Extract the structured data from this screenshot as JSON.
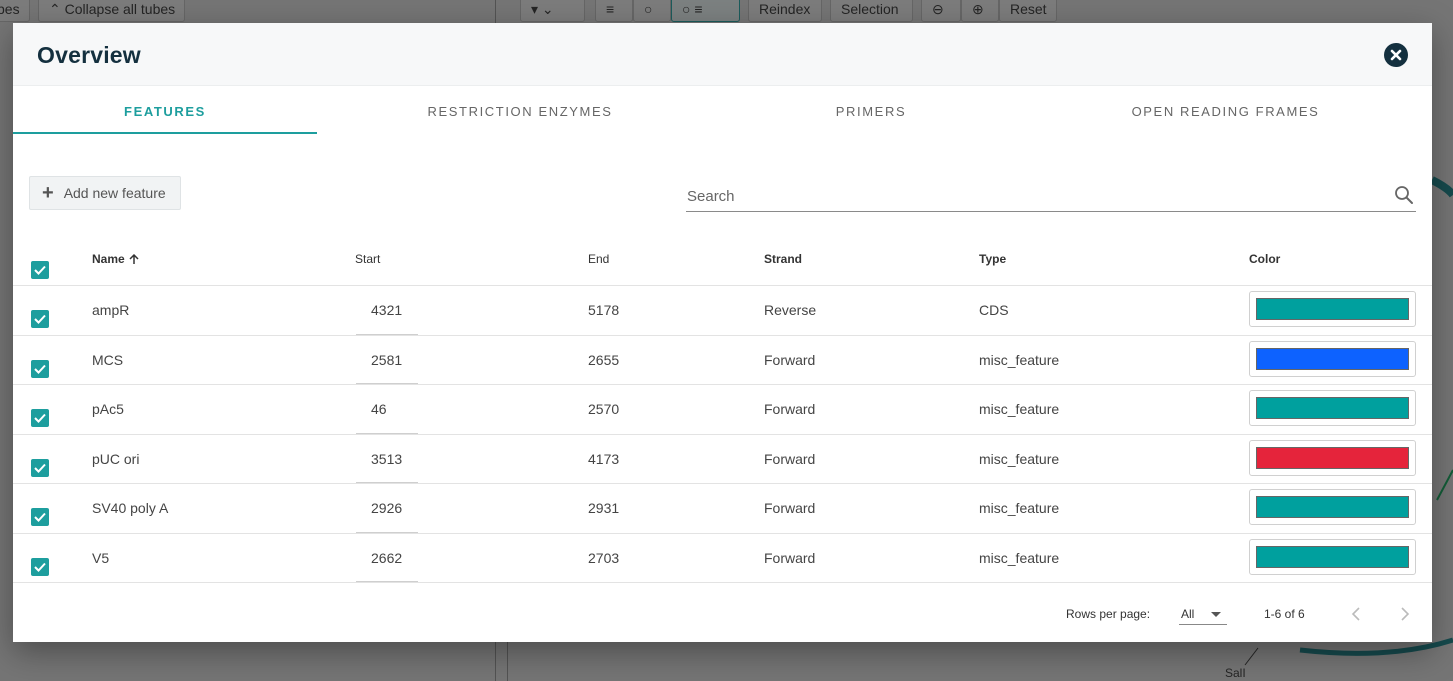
{
  "background": {
    "toolbar": {
      "partial_left_label": "bes",
      "collapse_label": "Collapse all tubes",
      "reindex_label": "Reindex",
      "selection_label": "Selection",
      "reset_label": "Reset"
    },
    "map_label": "SalI"
  },
  "modal": {
    "title": "Overview",
    "tabs": [
      {
        "label": "Features",
        "active": true
      },
      {
        "label": "Restriction Enzymes",
        "active": false
      },
      {
        "label": "Primers",
        "active": false
      },
      {
        "label": "Open Reading Frames",
        "active": false
      }
    ],
    "add_button_label": "Add new feature",
    "search": {
      "placeholder": "Search",
      "value": ""
    },
    "table": {
      "columns": {
        "name": "Name",
        "start": "Start",
        "end": "End",
        "strand": "Strand",
        "type": "Type",
        "color": "Color"
      },
      "sort": {
        "column": "Name",
        "direction": "ascending"
      },
      "all_selected": true,
      "rows": [
        {
          "name": "ampR",
          "start": "4321",
          "end": "5178",
          "strand": "Reverse",
          "type": "CDS",
          "color": "#00a09e",
          "selected": true
        },
        {
          "name": "MCS",
          "start": "2581",
          "end": "2655",
          "strand": "Forward",
          "type": "misc_feature",
          "color": "#0d62ff",
          "selected": true
        },
        {
          "name": "pAc5",
          "start": "46",
          "end": "2570",
          "strand": "Forward",
          "type": "misc_feature",
          "color": "#00a09e",
          "selected": true
        },
        {
          "name": "pUC ori",
          "start": "3513",
          "end": "4173",
          "strand": "Forward",
          "type": "misc_feature",
          "color": "#e5243b",
          "selected": true
        },
        {
          "name": "SV40 poly A",
          "start": "2926",
          "end": "2931",
          "strand": "Forward",
          "type": "misc_feature",
          "color": "#00a09e",
          "selected": true
        },
        {
          "name": "V5",
          "start": "2662",
          "end": "2703",
          "strand": "Forward",
          "type": "misc_feature",
          "color": "#00a09e",
          "selected": true
        }
      ]
    },
    "pagination": {
      "rows_per_page_label": "Rows per page:",
      "rows_per_page_value": "All",
      "range_text": "1-6 of 6"
    }
  },
  "colors": {
    "accent": "#1d9e9e",
    "title": "#14303f"
  },
  "icons": {
    "close": "close-circle-icon",
    "search": "search-icon",
    "add": "plus-icon",
    "sort": "arrow-up-icon",
    "checkbox": "check-icon",
    "prev": "chevron-left-icon",
    "next": "chevron-right-icon"
  }
}
